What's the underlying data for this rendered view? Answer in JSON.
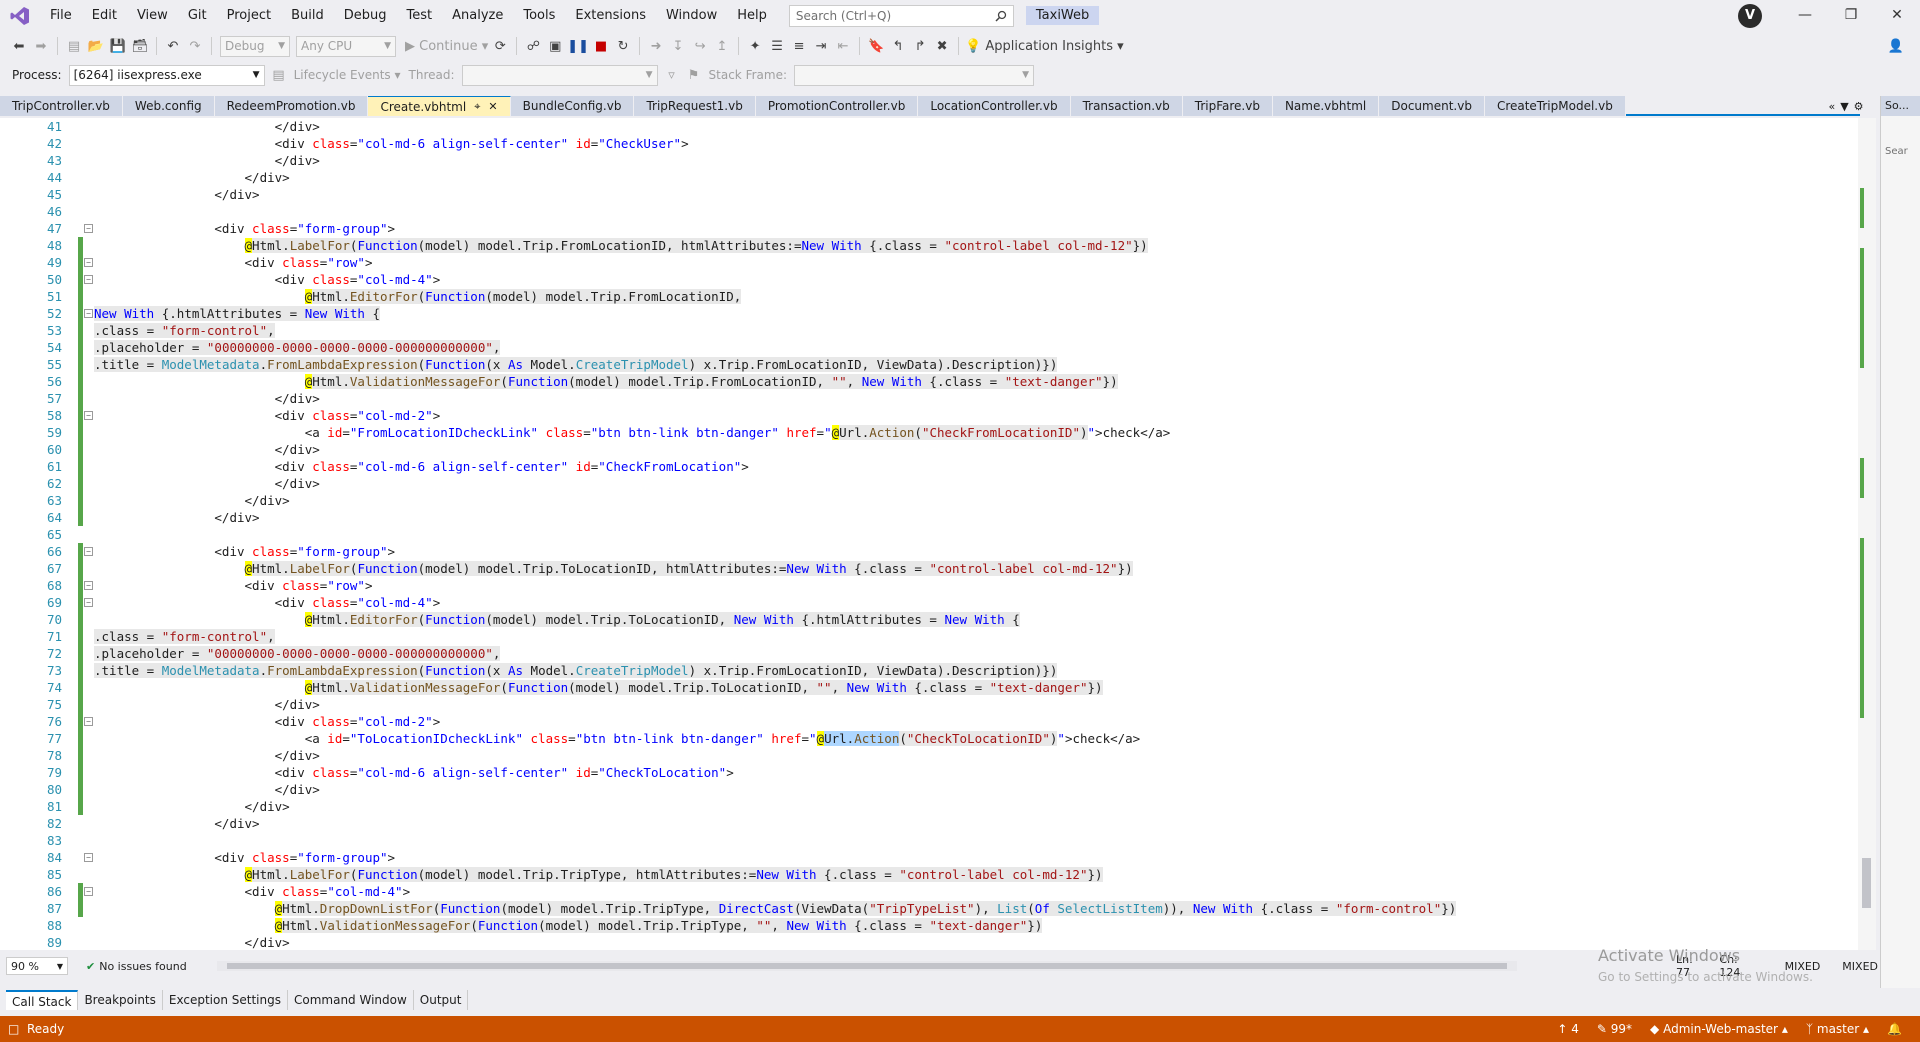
{
  "menu": {
    "items": [
      "File",
      "Edit",
      "View",
      "Git",
      "Project",
      "Build",
      "Debug",
      "Test",
      "Analyze",
      "Tools",
      "Extensions",
      "Window",
      "Help"
    ],
    "search_placeholder": "Search (Ctrl+Q)",
    "solution_name": "TaxiWeb",
    "user_initial": "V"
  },
  "toolbar": {
    "config": "Debug",
    "platform": "Any CPU",
    "continue_label": "Continue",
    "app_insights": "Application Insights",
    "process_label": "Process:",
    "process_value": "[6264] iisexpress.exe",
    "lifecycle_label": "Lifecycle Events",
    "thread_label": "Thread:",
    "stackframe_label": "Stack Frame:"
  },
  "tabs": [
    {
      "label": "TripController.vb",
      "active": false
    },
    {
      "label": "Web.config",
      "active": false
    },
    {
      "label": "RedeemPromotion.vb",
      "active": false
    },
    {
      "label": "Create.vbhtml",
      "active": true
    },
    {
      "label": "BundleConfig.vb",
      "active": false
    },
    {
      "label": "TripRequest1.vb",
      "active": false
    },
    {
      "label": "PromotionController.vb",
      "active": false
    },
    {
      "label": "LocationController.vb",
      "active": false
    },
    {
      "label": "Transaction.vb",
      "active": false
    },
    {
      "label": "TripFare.vb",
      "active": false
    },
    {
      "label": "Name.vbhtml",
      "active": false
    },
    {
      "label": "Document.vb",
      "active": false
    },
    {
      "label": "CreateTripModel.vb",
      "active": false
    }
  ],
  "side_panel": {
    "title": "So...",
    "search": "Sear"
  },
  "code_lines": [
    {
      "n": "41",
      "html": "                        &lt;/div&gt;"
    },
    {
      "n": "42",
      "html": "                        &lt;div <span class=\"at\">class</span>=<span class=\"k\">\"col-md-6 align-self-center\"</span> <span class=\"at\">id</span>=<span class=\"k\">\"CheckUser\"</span>&gt;"
    },
    {
      "n": "43",
      "html": "                        &lt;/div&gt;"
    },
    {
      "n": "44",
      "html": "                    &lt;/div&gt;"
    },
    {
      "n": "45",
      "html": "                &lt;/div&gt;"
    },
    {
      "n": "46",
      "html": ""
    },
    {
      "n": "47",
      "html": "                &lt;div <span class=\"at\">class</span>=<span class=\"k\">\"form-group\"</span>&gt;"
    },
    {
      "n": "48",
      "html": "                    <span class=\"rz\">@</span><span class=\"hl\">Html.<span class=\"m\">LabelFor</span>(<span class=\"k\">Function</span>(model) model.Trip.FromLocationID, htmlAttributes:=<span class=\"k\">New</span> <span class=\"k\">With</span> {.class = <span class=\"s\">\"control-label col-md-12\"</span>})</span>"
    },
    {
      "n": "49",
      "html": "                    &lt;div <span class=\"at\">class</span>=<span class=\"k\">\"row\"</span>&gt;"
    },
    {
      "n": "50",
      "html": "                        &lt;div <span class=\"at\">class</span>=<span class=\"k\">\"col-md-4\"</span>&gt;"
    },
    {
      "n": "51",
      "html": "                            <span class=\"rz\">@</span><span class=\"hl\">Html.<span class=\"m\">EditorFor</span>(<span class=\"k\">Function</span>(model) model.Trip.FromLocationID,</span>"
    },
    {
      "n": "52",
      "html": "<span class=\"hl\"><span class=\"k\">New</span> <span class=\"k\">With</span> {.htmlAttributes = <span class=\"k\">New</span> <span class=\"k\">With</span> {</span>"
    },
    {
      "n": "53",
      "html": "<span class=\"hl\">.class = <span class=\"s\">\"form-control\"</span>,</span>"
    },
    {
      "n": "54",
      "html": "<span class=\"hl\">.placeholder = <span class=\"s\">\"00000000-0000-0000-0000-000000000000\"</span>,</span>"
    },
    {
      "n": "55",
      "html": "<span class=\"hl\">.title = <span class=\"t\">ModelMetadata</span>.<span class=\"m\">FromLambdaExpression</span>(<span class=\"k\">Function</span>(x <span class=\"k\">As</span> Model.<span class=\"t\">CreateTripModel</span>) x.Trip.FromLocationID, ViewData).Description)})</span>"
    },
    {
      "n": "56",
      "html": "                            <span class=\"rz\">@</span><span class=\"hl\">Html.<span class=\"m\">ValidationMessageFor</span>(<span class=\"k\">Function</span>(model) model.Trip.FromLocationID, <span class=\"s\">\"\"</span>, <span class=\"k\">New</span> <span class=\"k\">With</span> {.class = <span class=\"s\">\"text-danger\"</span>})</span>"
    },
    {
      "n": "57",
      "html": "                        &lt;/div&gt;"
    },
    {
      "n": "58",
      "html": "                        &lt;div <span class=\"at\">class</span>=<span class=\"k\">\"col-md-2\"</span>&gt;"
    },
    {
      "n": "59",
      "html": "                            &lt;a <span class=\"at\">id</span>=<span class=\"k\">\"FromLocationIDcheckLink\"</span> <span class=\"at\">class</span>=<span class=\"k\">\"btn btn-link btn-danger\"</span> <span class=\"at\">href</span>=<span class=\"k\">\"</span><span class=\"rz\">@</span><span class=\"hl\">Url.<span class=\"m\">Action</span>(<span class=\"s\">\"CheckFromLocationID\"</span>)</span><span class=\"k\">\"</span>&gt;check&lt;/a&gt;"
    },
    {
      "n": "60",
      "html": "                        &lt;/div&gt;"
    },
    {
      "n": "61",
      "html": "                        &lt;div <span class=\"at\">class</span>=<span class=\"k\">\"col-md-6 align-self-center\"</span> <span class=\"at\">id</span>=<span class=\"k\">\"CheckFromLocation\"</span>&gt;"
    },
    {
      "n": "62",
      "html": "                        &lt;/div&gt;"
    },
    {
      "n": "63",
      "html": "                    &lt;/div&gt;"
    },
    {
      "n": "64",
      "html": "                &lt;/div&gt;"
    },
    {
      "n": "65",
      "html": ""
    },
    {
      "n": "66",
      "html": "                &lt;div <span class=\"at\">class</span>=<span class=\"k\">\"form-group\"</span>&gt;"
    },
    {
      "n": "67",
      "html": "                    <span class=\"rz\">@</span><span class=\"hl\">Html.<span class=\"m\">LabelFor</span>(<span class=\"k\">Function</span>(model) model.Trip.ToLocationID, htmlAttributes:=<span class=\"k\">New</span> <span class=\"k\">With</span> {.class = <span class=\"s\">\"control-label col-md-12\"</span>})</span>"
    },
    {
      "n": "68",
      "html": "                    &lt;div <span class=\"at\">class</span>=<span class=\"k\">\"row\"</span>&gt;"
    },
    {
      "n": "69",
      "html": "                        &lt;div <span class=\"at\">class</span>=<span class=\"k\">\"col-md-4\"</span>&gt;"
    },
    {
      "n": "70",
      "html": "                            <span class=\"rz\">@</span><span class=\"hl\">Html.<span class=\"m\">EditorFor</span>(<span class=\"k\">Function</span>(model) model.Trip.ToLocationID, <span class=\"k\">New</span> <span class=\"k\">With</span> {.htmlAttributes = <span class=\"k\">New</span> <span class=\"k\">With</span> {</span>"
    },
    {
      "n": "71",
      "html": "<span class=\"hl\">.class = <span class=\"s\">\"form-control\"</span>,</span>"
    },
    {
      "n": "72",
      "html": "<span class=\"hl\">.placeholder = <span class=\"s\">\"00000000-0000-0000-0000-000000000000\"</span>,</span>"
    },
    {
      "n": "73",
      "html": "<span class=\"hl\">.title = <span class=\"t\">ModelMetadata</span>.<span class=\"m\">FromLambdaExpression</span>(<span class=\"k\">Function</span>(x <span class=\"k\">As</span> Model.<span class=\"t\">CreateTripModel</span>) x.Trip.FromLocationID, ViewData).Description)})</span>"
    },
    {
      "n": "74",
      "html": "                            <span class=\"rz\">@</span><span class=\"hl\">Html.<span class=\"m\">ValidationMessageFor</span>(<span class=\"k\">Function</span>(model) model.Trip.ToLocationID, <span class=\"s\">\"\"</span>, <span class=\"k\">New</span> <span class=\"k\">With</span> {.class = <span class=\"s\">\"text-danger\"</span>})</span>"
    },
    {
      "n": "75",
      "html": "                        &lt;/div&gt;"
    },
    {
      "n": "76",
      "html": "                        &lt;div <span class=\"at\">class</span>=<span class=\"k\">\"col-md-2\"</span>&gt;"
    },
    {
      "n": "77",
      "html": "                            &lt;a <span class=\"at\">id</span>=<span class=\"k\">\"ToLocationIDcheckLink\"</span> <span class=\"at\">class</span>=<span class=\"k\">\"btn btn-link btn-danger\"</span> <span class=\"at\">href</span>=<span class=\"k\">\"</span><span class=\"rz\">@</span><span class=\"sel\">Url.<span class=\"m\">Action</span></span><span class=\"hl\">(<span class=\"s\">\"CheckToLocationID\"</span>)</span><span class=\"k\">\"</span>&gt;check&lt;/a&gt;"
    },
    {
      "n": "78",
      "html": "                        &lt;/div&gt;"
    },
    {
      "n": "79",
      "html": "                        &lt;div <span class=\"at\">class</span>=<span class=\"k\">\"col-md-6 align-self-center\"</span> <span class=\"at\">id</span>=<span class=\"k\">\"CheckToLocation\"</span>&gt;"
    },
    {
      "n": "80",
      "html": "                        &lt;/div&gt;"
    },
    {
      "n": "81",
      "html": "                    &lt;/div&gt;"
    },
    {
      "n": "82",
      "html": "                &lt;/div&gt;"
    },
    {
      "n": "83",
      "html": ""
    },
    {
      "n": "84",
      "html": "                &lt;div <span class=\"at\">class</span>=<span class=\"k\">\"form-group\"</span>&gt;"
    },
    {
      "n": "85",
      "html": "                    <span class=\"rz\">@</span><span class=\"hl\">Html.<span class=\"m\">LabelFor</span>(<span class=\"k\">Function</span>(model) model.Trip.TripType, htmlAttributes:=<span class=\"k\">New</span> <span class=\"k\">With</span> {.class = <span class=\"s\">\"control-label col-md-12\"</span>})</span>"
    },
    {
      "n": "86",
      "html": "                    &lt;div <span class=\"at\">class</span>=<span class=\"k\">\"col-md-4\"</span>&gt;"
    },
    {
      "n": "87",
      "html": "                        <span class=\"rz\">@</span><span class=\"hl\">Html.<span class=\"m\">DropDownListFor</span>(<span class=\"k\">Function</span>(model) model.Trip.TripType, <span class=\"k\">DirectCast</span>(ViewData(<span class=\"s\">\"TripTypeList\"</span>), <span class=\"t\">List</span>(<span class=\"k\">Of</span> <span class=\"t\">SelectListItem</span>)), <span class=\"k\">New</span> <span class=\"k\">With</span> {.class = <span class=\"s\">\"form-control\"</span>})</span>"
    },
    {
      "n": "88",
      "html": "                        <span class=\"rz\">@</span><span class=\"hl\">Html.<span class=\"m\">ValidationMessageFor</span>(<span class=\"k\">Function</span>(model) model.Trip.TripType, <span class=\"s\">\"\"</span>, <span class=\"k\">New</span> <span class=\"k\">With</span> {.class = <span class=\"s\">\"text-danger\"</span>})</span>"
    },
    {
      "n": "89",
      "html": "                    &lt;/div&gt;"
    }
  ],
  "editor_status": {
    "zoom": "90 %",
    "issues": "No issues found",
    "ln": "Ln: 77",
    "ch": "Ch: 124",
    "enc1": "MIXED",
    "enc2": "MIXED",
    "watermark_title": "Activate Windows",
    "watermark_sub": "Go to Settings to activate Windows."
  },
  "tool_windows": [
    "Call Stack",
    "Breakpoints",
    "Exception Settings",
    "Command Window",
    "Output"
  ],
  "status_bar": {
    "state": "Ready",
    "push_count": "4",
    "pending_changes": "99*",
    "repo": "Admin-Web-master",
    "branch": "master"
  },
  "colors": {
    "accent": "#007acc",
    "statusbar": "#ca5100",
    "change_saved": "#57a64a",
    "change_unsaved": "#f0d000"
  }
}
